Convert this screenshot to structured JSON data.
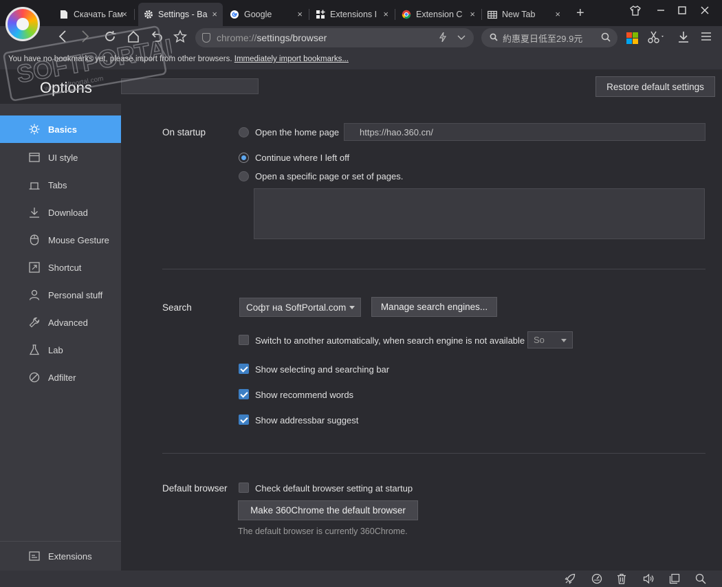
{
  "tabs": [
    {
      "title": "Скачать Гам",
      "icon": "document-icon",
      "active": false
    },
    {
      "title": "Settings - Ba",
      "icon": "gear-icon",
      "active": true
    },
    {
      "title": "Google",
      "icon": "google-icon",
      "active": false
    },
    {
      "title": "Extensions Ir",
      "icon": "extensions-icon",
      "active": false
    },
    {
      "title": "Extension Ce",
      "icon": "chrome-icon",
      "active": false
    },
    {
      "title": "New Tab",
      "icon": "newtab-grid-icon",
      "active": false
    }
  ],
  "close_glyph": "×",
  "address": {
    "scheme": "chrome://",
    "path": "settings/browser"
  },
  "search_box": {
    "query": "約惠夏日低至29.9元"
  },
  "bookmark_bar": {
    "message": "You have no bookmarks yet, please import from other browsers.",
    "link": "Immediately import bookmarks..."
  },
  "watermark": {
    "text": "SOFTPORTAL",
    "url": "www.softportal.com"
  },
  "options": {
    "title": "Options",
    "search_placeholder": "",
    "restore_label": "Restore default settings"
  },
  "sidebar": {
    "items": [
      {
        "label": "Basics",
        "icon": "sun-gear-icon",
        "active": true
      },
      {
        "label": "UI style",
        "icon": "window-icon",
        "active": false
      },
      {
        "label": "Tabs",
        "icon": "tab-icon",
        "active": false
      },
      {
        "label": "Download",
        "icon": "download-icon",
        "active": false
      },
      {
        "label": "Mouse Gesture",
        "icon": "mouse-icon",
        "active": false
      },
      {
        "label": "Shortcut",
        "icon": "shortcut-icon",
        "active": false
      },
      {
        "label": "Personal stuff",
        "icon": "person-icon",
        "active": false
      },
      {
        "label": "Advanced",
        "icon": "wrench-icon",
        "active": false
      },
      {
        "label": "Lab",
        "icon": "flask-icon",
        "active": false
      },
      {
        "label": "Adfilter",
        "icon": "block-icon",
        "active": false
      }
    ],
    "bottom": {
      "label": "Extensions",
      "icon": "extensions-icon"
    }
  },
  "startup": {
    "label": "On startup",
    "open_home": "Open the home page",
    "home_url": "https://hao.360.cn/",
    "continue": "Continue where I left off",
    "specific": "Open a specific page or set of pages.",
    "selected": "continue"
  },
  "search_section": {
    "label": "Search",
    "engine": "Софт на SoftPortal.com",
    "manage_label": "Manage search engines...",
    "auto_switch": {
      "label": "Switch to another automatically, when search engine is not available",
      "checked": false,
      "fallback": "So"
    },
    "show_bar": {
      "label": "Show selecting and searching bar",
      "checked": true
    },
    "recommend": {
      "label": "Show recommend words",
      "checked": true
    },
    "addressbar": {
      "label": "Show addressbar suggest",
      "checked": true
    }
  },
  "default_browser": {
    "label": "Default browser",
    "check": {
      "label": "Check default browser setting at startup",
      "checked": false
    },
    "make_default_label": "Make 360Chrome the default browser",
    "status": "The default browser is currently 360Chrome."
  },
  "colors": {
    "accent": "#4aa1f2",
    "sidebar_bg": "#3a3a40",
    "content_bg": "#2b2b30"
  }
}
